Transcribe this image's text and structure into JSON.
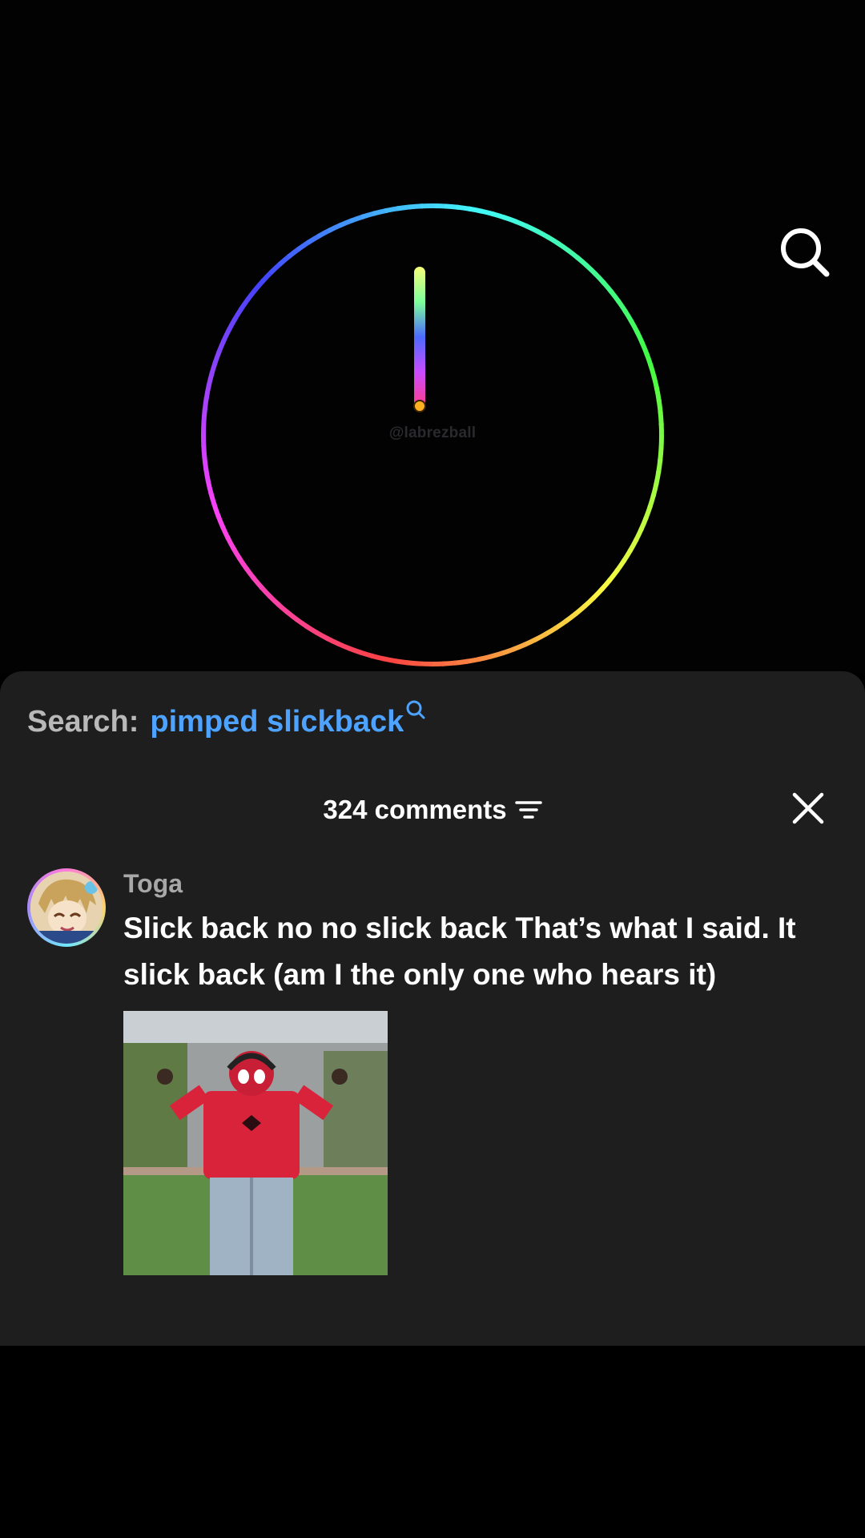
{
  "video": {
    "watermark": "@labrezball"
  },
  "comments_sheet": {
    "search_prefix": "Search:",
    "search_query": "pimped slickback",
    "comment_count_label": "324 comments",
    "comments": [
      {
        "username": "Toga",
        "text": "Slick back no no slick back That’s what I said. It slick back (am I the only one who hears it)"
      }
    ]
  },
  "icons": {
    "top_search": "search-icon",
    "query_search": "search-icon",
    "sort": "filter-icon",
    "close": "close-icon"
  },
  "colors": {
    "sheet_background": "#1e1e1f",
    "query_link": "#4da3ff",
    "username": "#a8a8a8"
  }
}
